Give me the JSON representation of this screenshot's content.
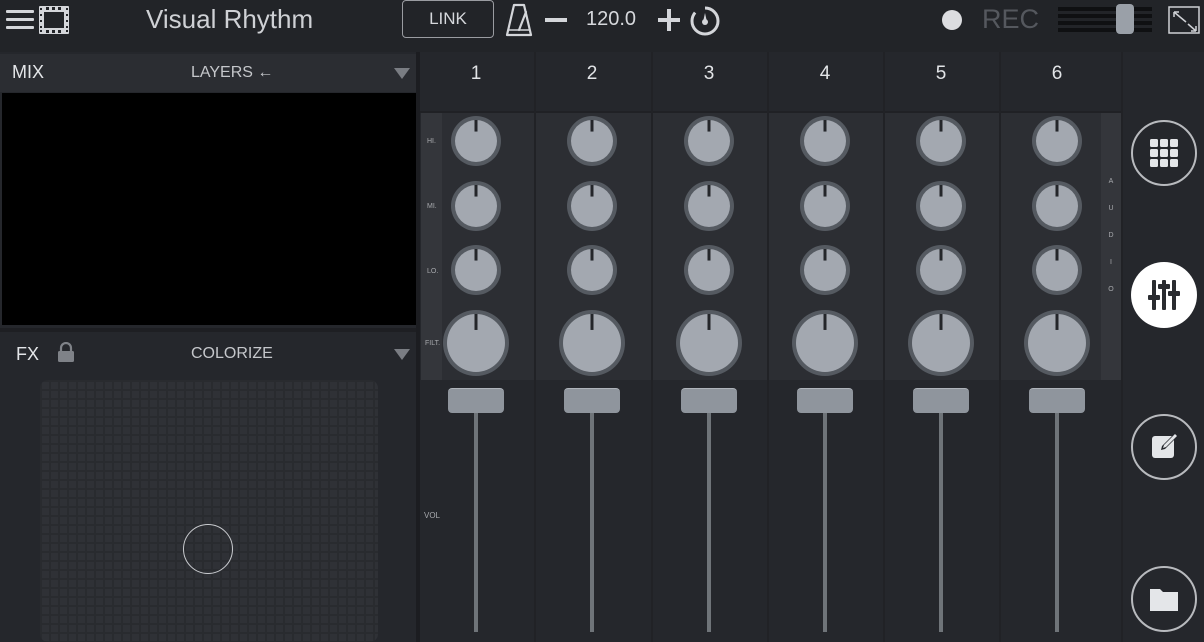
{
  "header": {
    "app_title": "Visual Rhythm",
    "link_label": "LINK",
    "bpm": "120.0",
    "rec_label": "REC"
  },
  "mix": {
    "label": "MIX",
    "source_label": "LAYERS ←"
  },
  "fx": {
    "label": "FX",
    "effect_name": "COLORIZE"
  },
  "mixer": {
    "band_labels": [
      "HI.",
      "MI.",
      "LO.",
      "FILT."
    ],
    "audio_label": [
      "A",
      "U",
      "D",
      "I",
      "O"
    ],
    "vol_label": "VOL",
    "channels": [
      {
        "number": "1"
      },
      {
        "number": "2"
      },
      {
        "number": "3"
      },
      {
        "number": "4"
      },
      {
        "number": "5"
      },
      {
        "number": "6"
      }
    ]
  },
  "sidebar": {
    "icons": [
      "grid-icon",
      "mixer-sliders-icon",
      "edit-icon",
      "folder-icon"
    ],
    "active": "mixer-sliders-icon"
  },
  "colors": {
    "background": "#25272c",
    "knob": "#a3a8b0",
    "knob_ring": "#555a61",
    "fader_handle": "#8f959d",
    "active_button": "#ffffff"
  }
}
